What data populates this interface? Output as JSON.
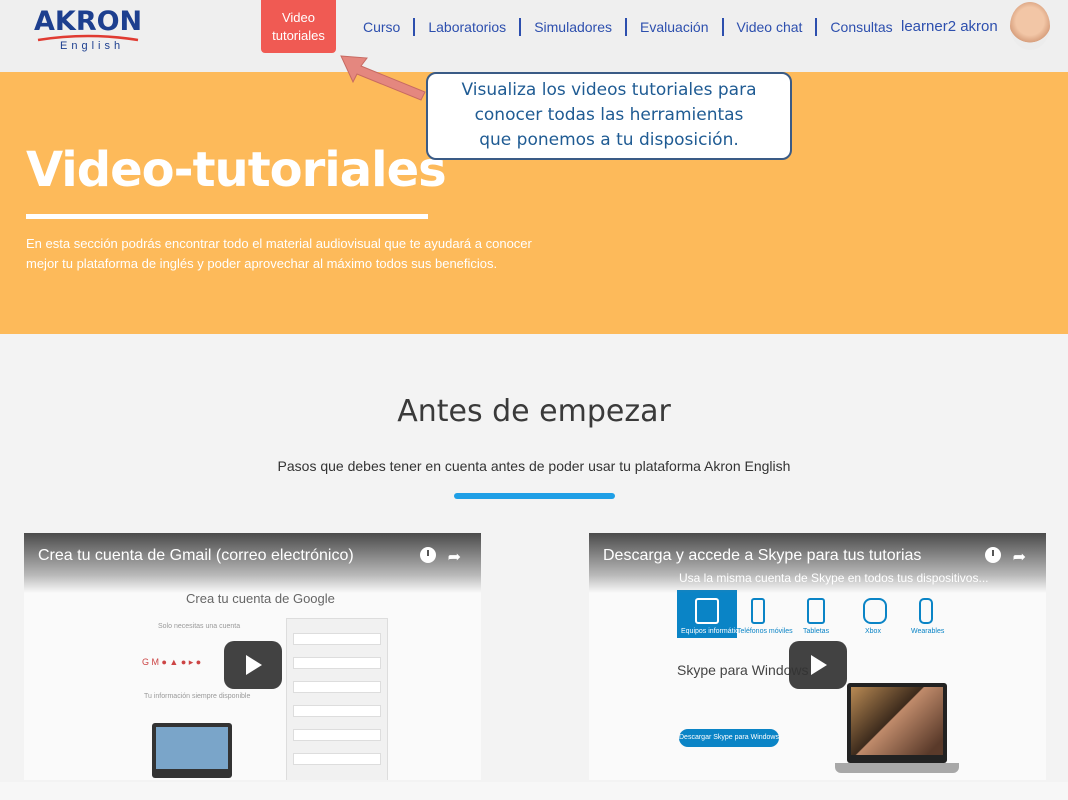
{
  "header": {
    "logo_main": "AKRON",
    "logo_sub": "English",
    "active_nav_line1": "Video",
    "active_nav_line2": "tutoriales",
    "nav": [
      "Curso",
      "Laboratorios",
      "Simuladores",
      "Evaluación",
      "Video chat",
      "Consultas"
    ],
    "user_name": "learner2 akron"
  },
  "callout": {
    "line1": "Visualiza los videos tutoriales para",
    "line2": "conocer todas las herramientas",
    "line3": "que ponemos a tu disposición."
  },
  "hero": {
    "title": "Video-tutoriales",
    "description": "En esta sección podrás encontrar todo el material audiovisual que te ayudará a conocer mejor tu plataforma de inglés y poder aprovechar al máximo todos sus beneficios."
  },
  "section": {
    "title": "Antes de empezar",
    "subtitle": "Pasos que debes tener en cuenta antes de poder usar tu plataforma Akron English"
  },
  "videos": [
    {
      "title": "Crea tu cuenta de Gmail (correo electrónico)",
      "content_heading": "Crea tu cuenta de Google",
      "content_text1": "Solo necesitas una cuenta",
      "content_text2": "Tu información siempre disponible"
    },
    {
      "title": "Descarga y accede a Skype para tus tutorias",
      "subtitle": "Usa la misma cuenta de Skype en todos tus dispositivos...",
      "content_heading": "Skype para Windows",
      "button_text": "Descargar Skype para Windows",
      "categories": [
        "Equipos informáticos",
        "Teléfonos móviles",
        "Tabletas",
        "Xbox",
        "Wearables"
      ]
    }
  ],
  "colors": {
    "brand_blue": "#2d4fae",
    "active_red": "#f05a53",
    "hero_orange": "#fdba5a",
    "accent_bar": "#1f9fe6"
  }
}
